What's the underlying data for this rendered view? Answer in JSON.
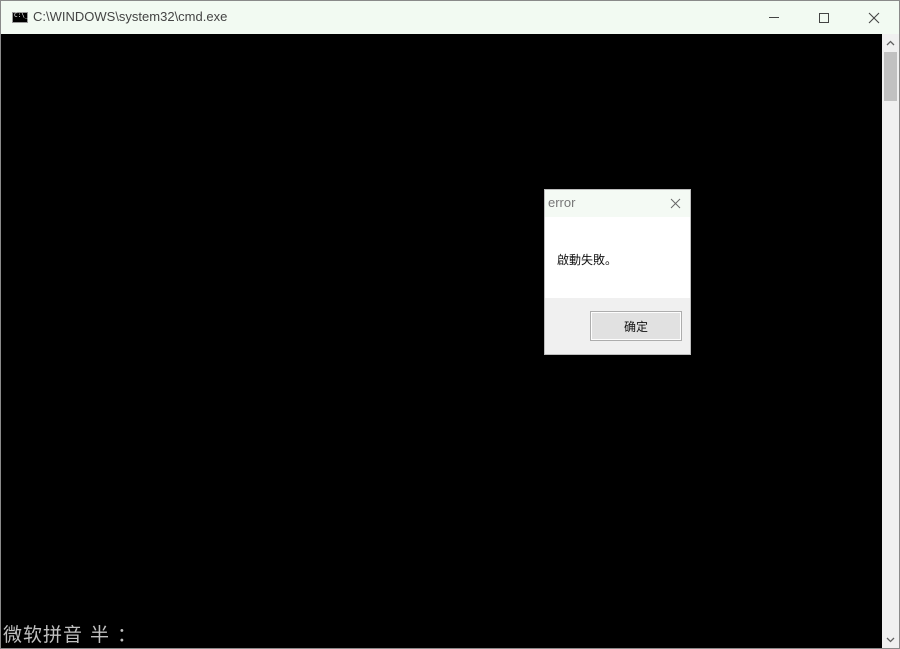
{
  "window": {
    "title": "C:\\WINDOWS\\system32\\cmd.exe",
    "icon": "cmd-console-icon",
    "controls": {
      "minimize_icon": "minimize-icon",
      "maximize_icon": "maximize-icon",
      "close_icon": "close-icon"
    }
  },
  "console": {
    "background": "#000000",
    "ime_status": "微软拼音 半 ："
  },
  "dialog": {
    "title": "error",
    "message": "啟動失敗。",
    "ok_label": "确定",
    "close_icon": "close-icon"
  },
  "colors": {
    "titlebar": "#f2faf2",
    "console": "#000000",
    "dialog_bg": "#ffffff",
    "button": "#e1e1e1"
  }
}
